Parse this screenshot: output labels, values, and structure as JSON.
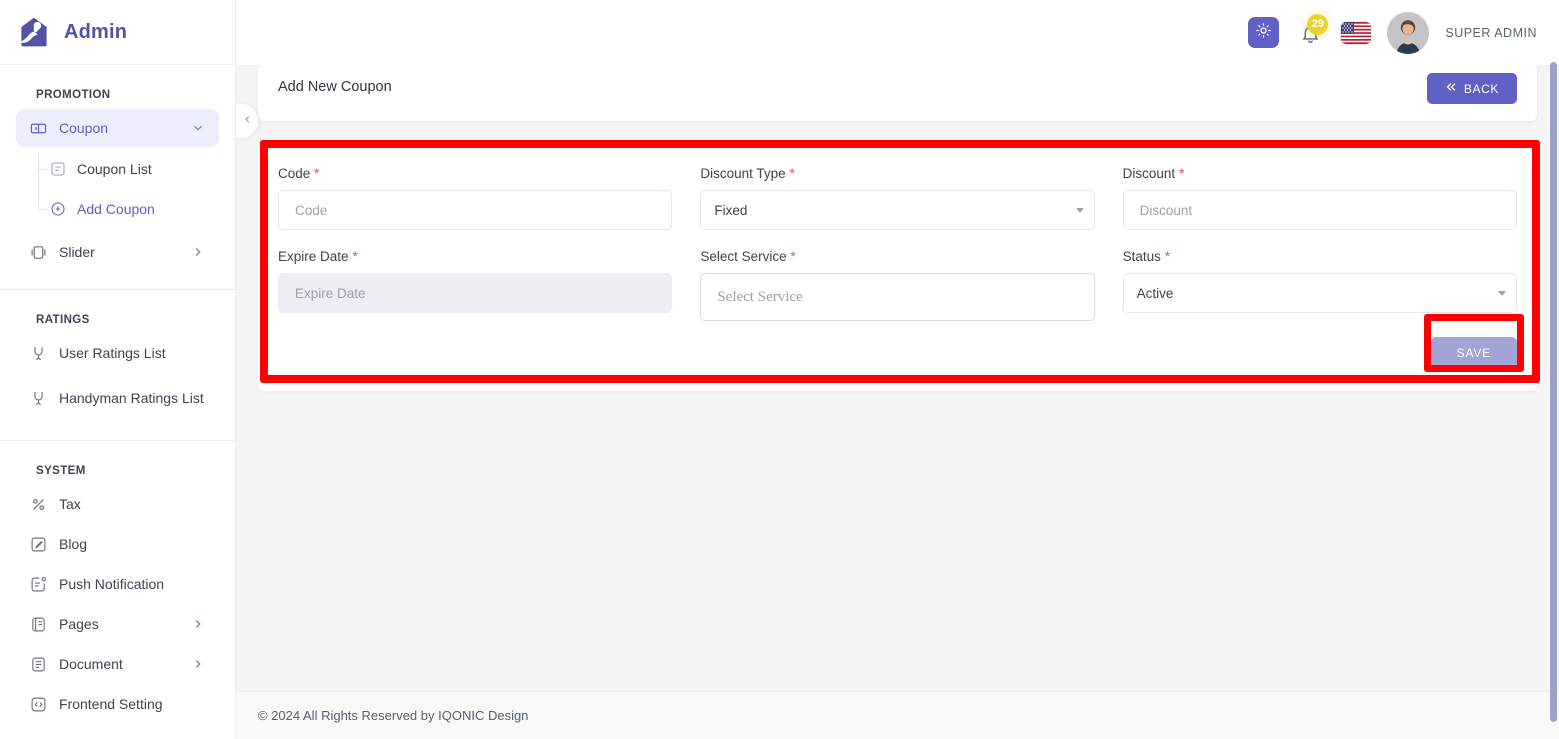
{
  "brand": {
    "name": "Admin",
    "logo_icon": "admin-logo-icon"
  },
  "sidebar": {
    "sections": [
      {
        "title": "PROMOTION",
        "items": [
          {
            "label": "Coupon",
            "icon": "ticket-icon",
            "state": "active",
            "chevron": "chevron-down-icon"
          },
          {
            "label": "Slider",
            "icon": "slider-icon",
            "state": "normal",
            "chevron": "chevron-right-icon"
          }
        ],
        "sub_items": [
          {
            "label": "Coupon List",
            "icon": "list-check-icon",
            "state": "normal"
          },
          {
            "label": "Add Coupon",
            "icon": "plus-circle-icon",
            "state": "current"
          }
        ]
      },
      {
        "title": "RATINGS",
        "items": [
          {
            "label": "User Ratings List",
            "icon": "medal-icon",
            "state": "normal",
            "chevron": ""
          },
          {
            "label": "Handyman Ratings List",
            "icon": "medal-icon",
            "state": "normal",
            "chevron": ""
          }
        ]
      },
      {
        "title": "SYSTEM",
        "items": [
          {
            "label": "Tax",
            "icon": "percent-icon",
            "state": "normal",
            "chevron": ""
          },
          {
            "label": "Blog",
            "icon": "blog-edit-icon",
            "state": "normal",
            "chevron": ""
          },
          {
            "label": "Push Notification",
            "icon": "push-notification-icon",
            "state": "normal",
            "chevron": ""
          },
          {
            "label": "Pages",
            "icon": "pages-icon",
            "state": "normal",
            "chevron": "chevron-right-icon"
          },
          {
            "label": "Document",
            "icon": "document-icon",
            "state": "normal",
            "chevron": "chevron-right-icon"
          },
          {
            "label": "Frontend Setting",
            "icon": "code-icon",
            "state": "normal",
            "chevron": ""
          }
        ]
      }
    ],
    "collapse_icon": "chevron-left-icon"
  },
  "topbar": {
    "theme_toggle_icon": "sun-icon",
    "notification_icon": "bell-icon",
    "notification_count": "29",
    "language_flag": "us-flag-icon",
    "avatar_icon": "user-avatar",
    "user_name": "SUPER ADMIN"
  },
  "page": {
    "title": "Add New Coupon",
    "back_label": "BACK",
    "back_icon": "double-chevron-left-icon"
  },
  "form": {
    "fields": {
      "code": {
        "label": "Code",
        "required": "*",
        "placeholder": "Code",
        "value": ""
      },
      "discount_type": {
        "label": "Discount Type",
        "required": "*",
        "value": "Fixed",
        "caret_icon": "caret-down-icon"
      },
      "discount": {
        "label": "Discount",
        "required": "*",
        "placeholder": "Discount",
        "value": ""
      },
      "expire_date": {
        "label": "Expire Date",
        "required": "*",
        "placeholder": "Expire Date",
        "value": ""
      },
      "select_service": {
        "label": "Select Service",
        "required": "*",
        "placeholder": "Select Service",
        "value": ""
      },
      "status": {
        "label": "Status",
        "required": "*",
        "value": "Active",
        "caret_icon": "caret-down-icon"
      }
    },
    "save_label": "SAVE"
  },
  "footer": {
    "text": "© 2024 All Rights Reserved by IQONIC Design"
  },
  "colors": {
    "brand_purple": "#5f61c4",
    "active_nav_bg": "#eceefb",
    "required_red": "#ef4a5c",
    "badge_yellow": "#e8d32f",
    "highlight_red": "#fe0000",
    "save_disabled": "#a3a4d6",
    "page_bg": "#f4f4f5"
  }
}
